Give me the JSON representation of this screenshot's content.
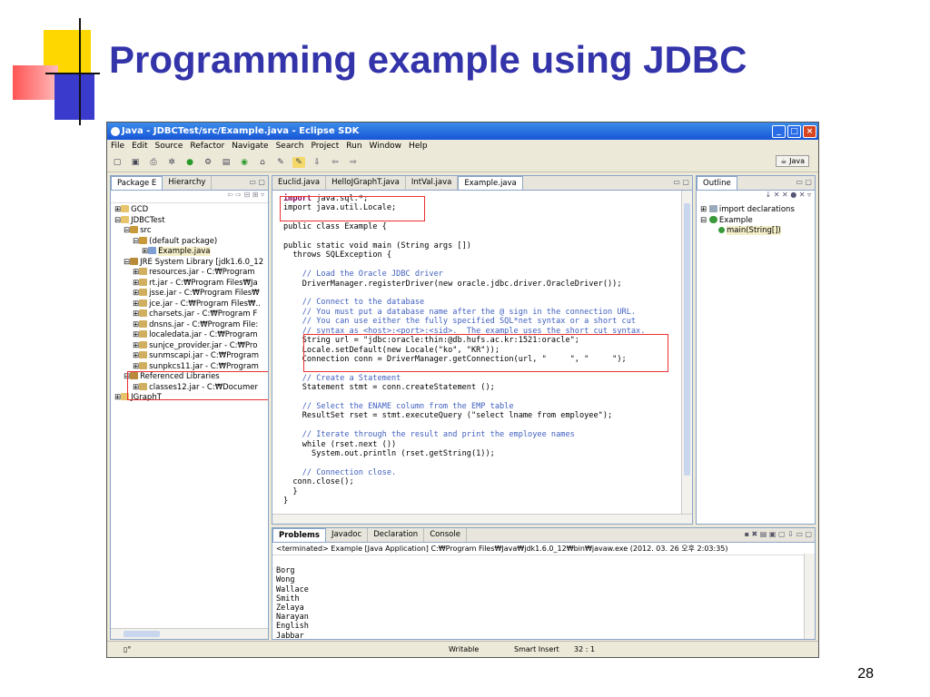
{
  "slide": {
    "title": "Programming example using JDBC",
    "page_number": "28"
  },
  "window": {
    "title": "Java - JDBCTest/src/Example.java - Eclipse SDK",
    "menu": [
      "File",
      "Edit",
      "Source",
      "Refactor",
      "Navigate",
      "Search",
      "Project",
      "Run",
      "Window",
      "Help"
    ],
    "perspective": "Java"
  },
  "explorer": {
    "tabs": [
      "Package E",
      "Hierarchy"
    ],
    "items": [
      "GCD",
      "JDBCTest",
      "src",
      "(default package)",
      "Example.java",
      "JRE System Library [jdk1.6.0_12",
      "resources.jar - C:₩Program",
      "rt.jar - C:₩Program Files₩Ja",
      "jsse.jar - C:₩Program Files₩",
      "jce.jar - C:₩Program Files₩..",
      "charsets.jar - C:₩Program F",
      "dnsns.jar - C:₩Program File:",
      "localedata.jar - C:₩Program",
      "sunjce_provider.jar - C:₩Pro",
      "sunmscapi.jar - C:₩Program",
      "sunpkcs11.jar - C:₩Program",
      "Referenced Libraries",
      "classes12.jar - C:₩Documer",
      "JGraphT"
    ]
  },
  "editor": {
    "tabs": [
      "Euclid.java",
      "HelloJGraphT.java",
      "IntVal.java",
      "Example.java"
    ],
    "code": {
      "l1": "import java.sql.*;",
      "l2": "import java.util.Locale;",
      "l3": "public class Example {",
      "l4": "public static void main (String args [])",
      "l5": "throws SQLException {",
      "l6": "// Load the Oracle JDBC driver",
      "l7": "DriverManager.registerDriver(new oracle.jdbc.driver.OracleDriver());",
      "l8": "// Connect to the database",
      "l9": "// You must put a database name after the @ sign in the connection URL.",
      "l10": "// You can use either the fully specified SQL*net syntax or a short cut",
      "l11": "// syntax as <host>:<port>:<sid>.  The example uses the short cut syntax.",
      "l12": "String url = \"jdbc:oracle:thin:@db.hufs.ac.kr:1521:oracle\";",
      "l13": "Locale.setDefault(new Locale(\"ko\", \"KR\"));",
      "l14": "Connection conn = DriverManager.getConnection(url, \"     \", \"     \");",
      "l15": "// Create a Statement",
      "l16": "Statement stmt = conn.createStatement ();",
      "l17": "// Select the ENAME column from the EMP table",
      "l18": "ResultSet rset = stmt.executeQuery (\"select lname from employee\");",
      "l19": "// Iterate through the result and print the employee names",
      "l20": "while (rset.next ())",
      "l21": "System.out.println (rset.getString(1));",
      "l22": "// Connection close.",
      "l23": "conn.close();",
      "l24": "}",
      "l25": "}"
    }
  },
  "outline": {
    "tab": "Outline",
    "items": [
      "import declarations",
      "Example",
      "main(String[])"
    ]
  },
  "bottom": {
    "tabs": [
      "Problems",
      "Javadoc",
      "Declaration",
      "Console"
    ],
    "terminated": "<terminated> Example [Java Application] C:₩Program Files₩Java₩jdk1.6.0_12₩bin₩javaw.exe (2012. 03. 26 오후 2:03:35)",
    "output": [
      "Borg",
      "Wong",
      "Wallace",
      "Smith",
      "Zelaya",
      "Narayan",
      "English",
      "Jabbar"
    ]
  },
  "status": {
    "writable": "Writable",
    "insert": "Smart Insert",
    "position": "32 : 1"
  }
}
